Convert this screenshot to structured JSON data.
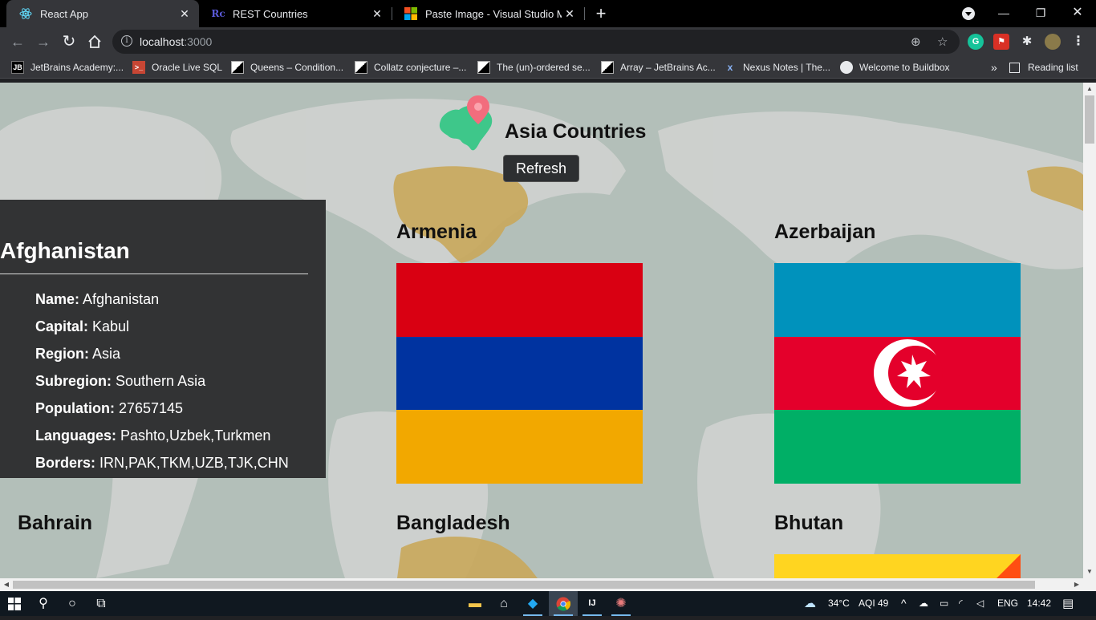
{
  "browser": {
    "tabs": [
      {
        "label": "React App",
        "favicon": "react-icon",
        "active": true
      },
      {
        "label": "REST Countries",
        "favicon": "rc-icon",
        "active": false
      },
      {
        "label": "Paste Image - Visual Studio Mark",
        "favicon": "microsoft-icon",
        "active": false
      }
    ],
    "url_host": "localhost",
    "url_port": ":3000",
    "bookmarks": [
      {
        "label": "JetBrains Academy:...",
        "icon": "JB"
      },
      {
        "label": "Oracle Live SQL",
        "icon": ">_"
      },
      {
        "label": "Queens – Condition...",
        "icon": ""
      },
      {
        "label": "Collatz conjecture –...",
        "icon": ""
      },
      {
        "label": "The (un)-ordered se...",
        "icon": ""
      },
      {
        "label": "Array – JetBrains Ac...",
        "icon": ""
      },
      {
        "label": "Nexus Notes | The...",
        "icon": "x"
      },
      {
        "label": "Welcome to Buildbox",
        "icon": ""
      }
    ],
    "more_bookmarks": "»",
    "reading_list": "Reading list"
  },
  "page": {
    "title": "Asia Countries",
    "refresh_label": "Refresh",
    "detail": {
      "title": "Afghanistan",
      "rows": [
        {
          "label": "Name:",
          "value": " Afghanistan"
        },
        {
          "label": "Capital:",
          "value": " Kabul"
        },
        {
          "label": "Region:",
          "value": " Asia"
        },
        {
          "label": "Subregion:",
          "value": " Southern Asia"
        },
        {
          "label": "Population:",
          "value": " 27657145"
        },
        {
          "label": "Languages:",
          "value": " Pashto,Uzbek,Turkmen"
        },
        {
          "label": "Borders:",
          "value": " IRN,PAK,TKM,UZB,TJK,CHN"
        }
      ]
    },
    "countries": [
      {
        "name": "Armenia"
      },
      {
        "name": "Azerbaijan"
      },
      {
        "name": "Bahrain"
      },
      {
        "name": "Bangladesh"
      },
      {
        "name": "Bhutan"
      }
    ],
    "colors": {
      "armenia": [
        "#d90012",
        "#0033a0",
        "#f2a800"
      ],
      "azerbaijan": [
        "#0092bc",
        "#e4002b",
        "#00af66"
      ],
      "bhutan": [
        "#ffd520",
        "#ff4e12"
      ]
    }
  },
  "taskbar": {
    "weather": "34°C",
    "aqi": "AQI 49",
    "lang": "ENG",
    "time": "14:42"
  }
}
